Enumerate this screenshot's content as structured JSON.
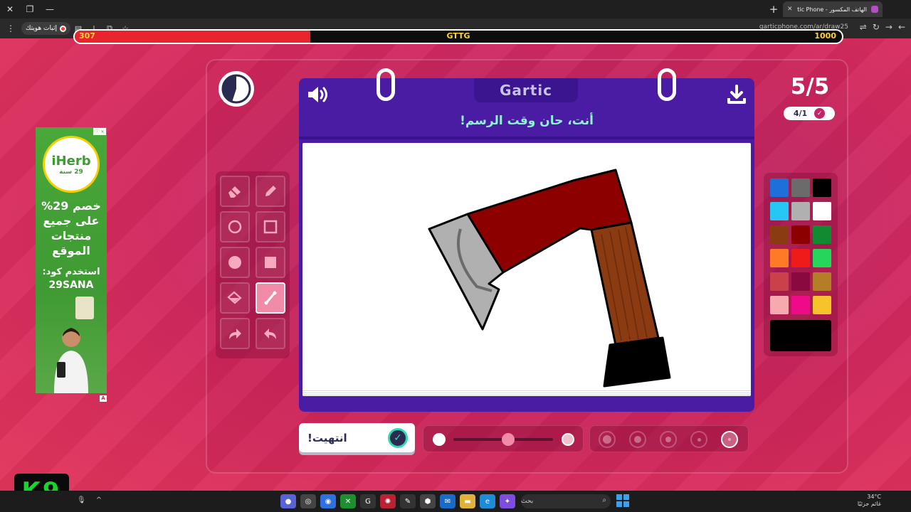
{
  "browser": {
    "tab_title": "الهاتف المكسور - Gartic Phone",
    "new_tab_label": "+",
    "close_tab_label": "✕",
    "window_close": "✕",
    "window_restore": "❐",
    "window_minimize": "—",
    "record_chip_label": "إثبات هويتك",
    "url": "garticphone.com/ar/draw25",
    "menu_label": "⋮"
  },
  "overlay": {
    "progress_current": "307",
    "progress_label": "GTTG",
    "progress_goal": "1000",
    "progress_fraction": 0.307
  },
  "game": {
    "logo_text": "Gartic",
    "prompt": "أنت، حان وقت الرسم!",
    "round": "5/5",
    "done_count": "4/1",
    "done_button_label": "انتهيت!",
    "timer_remaining_fraction": 0.45
  },
  "tools": [
    {
      "name": "eraser",
      "active": false
    },
    {
      "name": "pencil",
      "active": false
    },
    {
      "name": "circle-outline",
      "active": false
    },
    {
      "name": "square-outline",
      "active": false
    },
    {
      "name": "circle-filled",
      "active": false
    },
    {
      "name": "square-filled",
      "active": false
    },
    {
      "name": "fill-bucket",
      "active": false
    },
    {
      "name": "line",
      "active": true
    },
    {
      "name": "redo",
      "active": false
    },
    {
      "name": "undo",
      "active": false
    }
  ],
  "palette": {
    "colors": [
      "#1e6fd9",
      "#6b6b6b",
      "#000000",
      "#26c6f5",
      "#b0b0b0",
      "#ffffff",
      "#8a3b12",
      "#8c0000",
      "#118a31",
      "#ff7a26",
      "#ef1b1b",
      "#25d65a",
      "#c8414b",
      "#8a0a3f",
      "#b57d28",
      "#f7a9b0",
      "#ee0b8a",
      "#f7c32c"
    ],
    "current": "#000000"
  },
  "opacity_level": 0.55,
  "brush_sizes": [
    {
      "size": "xl",
      "active": false
    },
    {
      "size": "l",
      "active": false
    },
    {
      "size": "m",
      "active": false
    },
    {
      "size": "s",
      "active": false
    },
    {
      "size": "xs",
      "active": true
    }
  ],
  "ad": {
    "brand": "iHerb",
    "years": "29 سنة",
    "headline": "خصم 29% على جميع منتجات الموقع",
    "code_label": "استخدم كود:",
    "code": "29SANA",
    "badge": "A"
  },
  "stream_logo": "K9",
  "taskbar": {
    "search_placeholder": "بحث",
    "temperature": "34°C",
    "weather": "غائم جزئيًا"
  }
}
